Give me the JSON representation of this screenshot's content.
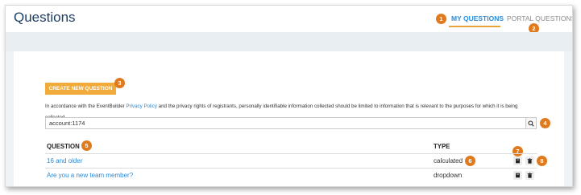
{
  "header": {
    "title": "Questions",
    "tabs": [
      {
        "label": "MY QUESTIONS",
        "active": true,
        "badge": "1"
      },
      {
        "label": "PORTAL QUESTIONS",
        "active": false,
        "badge": "2"
      }
    ]
  },
  "toolbar": {
    "create_label": "CREATE NEW QUESTION",
    "create_badge": "3"
  },
  "notice": {
    "prefix": "In accordance with the EventBuilder ",
    "link": "Privacy Policy",
    "suffix": " and the privacy rights of registrants, personally identifiable information collected should be limited to information that is relevant to the purposes for which it is being collected."
  },
  "search": {
    "value": "account:1174",
    "badge": "4"
  },
  "table": {
    "columns": {
      "question": "QUESTION",
      "type": "TYPE"
    },
    "question_badge": "5",
    "rows": [
      {
        "question": "16 and older",
        "type": "calculated",
        "type_badge": "6"
      },
      {
        "question": "Are you a new team member?",
        "type": "dropdown"
      }
    ],
    "edit_badge": "7",
    "delete_badge": "8"
  },
  "colors": {
    "accent": "#e07a1f",
    "button": "#f0ab3a",
    "link": "#2c8ad6",
    "title": "#1f3f66"
  },
  "icons": [
    "search-icon",
    "edit-icon",
    "trash-icon"
  ]
}
